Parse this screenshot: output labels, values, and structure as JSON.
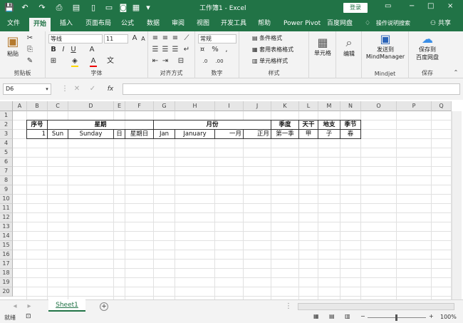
{
  "window": {
    "title": "工作簿1 - Excel",
    "login_label": "登录",
    "controls": [
      "▭",
      "−",
      "□",
      "×"
    ]
  },
  "quick_access": [
    "save-icon",
    "undo-icon",
    "redo-icon",
    "print-preview-icon",
    "new-icon",
    "open-icon",
    "grid-icon",
    "more-icon"
  ],
  "tabs": [
    "文件",
    "开始",
    "插入",
    "页面布局",
    "公式",
    "数据",
    "审阅",
    "视图",
    "开发工具",
    "帮助",
    "Power Pivot",
    "百度网盘",
    "操作说明搜索",
    "共享"
  ],
  "ribbon": {
    "clipboard": {
      "label": "剪贴板",
      "paste": "粘贴"
    },
    "font": {
      "label": "字体",
      "font_name": "等线",
      "font_size": "11"
    },
    "alignment": {
      "label": "对齐方式"
    },
    "number": {
      "label": "数字",
      "format": "常规"
    },
    "styles": {
      "label": "样式",
      "conditional": "条件格式",
      "table": "套用表格格式",
      "cell": "单元格样式"
    },
    "cells": {
      "label": "单元格"
    },
    "editing": {
      "label": "编辑"
    },
    "mindjet": {
      "label": "Mindjet",
      "send": "发送到",
      "target": "MindManager"
    },
    "save": {
      "label": "保存",
      "save_to": "保存到",
      "target": "百度网盘"
    }
  },
  "formula": {
    "name_box": "D6",
    "fx": "fx",
    "value": ""
  },
  "columns": [
    "A",
    "B",
    "C",
    "D",
    "E",
    "F",
    "G",
    "H",
    "I",
    "J",
    "K",
    "L",
    "M",
    "N",
    "O",
    "P",
    "Q"
  ],
  "rows": [
    "1",
    "2",
    "3",
    "4",
    "5",
    "6",
    "7",
    "8",
    "9",
    "10",
    "11",
    "12",
    "13",
    "14",
    "15",
    "16",
    "17",
    "18",
    "19",
    "20"
  ],
  "table": {
    "row2": {
      "B": "序号",
      "week": "星期",
      "month": "月份",
      "K": "季度",
      "L": "天干",
      "M": "地支",
      "N": "季节"
    },
    "row3": {
      "B": "1",
      "C": "Sun",
      "D": "Sunday",
      "E": "日",
      "F": "星期日",
      "G": "Jan",
      "H": "January",
      "I": "一月",
      "J": "正月",
      "K": "第一季",
      "L": "甲",
      "M": "子",
      "N": "春"
    }
  },
  "sheets": [
    "Sheet1"
  ],
  "status": {
    "ready": "就绪",
    "zoom": "100%"
  }
}
